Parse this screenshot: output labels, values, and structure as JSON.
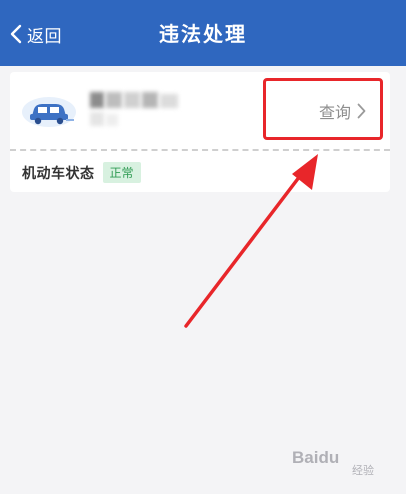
{
  "header": {
    "back_label": "返回",
    "title": "违法处理",
    "background": "#2f67bf"
  },
  "vehicle_card": {
    "car_icon": "car-icon",
    "plate_obscured": true,
    "query_label": "查询",
    "status_label": "机动车状态",
    "status_value": "正常",
    "status_color": "#2f9b53"
  },
  "annotation": {
    "highlight_color": "#e8262a"
  },
  "watermark": {
    "text": "Baidu",
    "sub": "经验"
  }
}
